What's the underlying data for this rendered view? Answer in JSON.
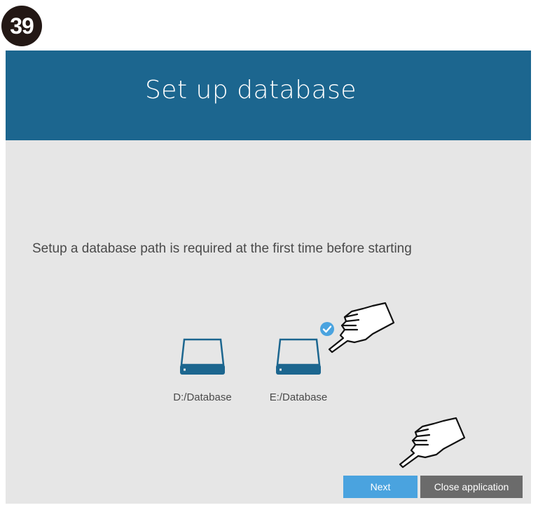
{
  "step": {
    "number": "39"
  },
  "dialog": {
    "title": "Set up database",
    "instruction": "Setup a database path is required at the first time before starting"
  },
  "drives": [
    {
      "label": "D:/Database",
      "selected": false,
      "icon": "hard-drive-icon"
    },
    {
      "label": "E:/Database",
      "selected": true,
      "icon": "hard-drive-icon"
    }
  ],
  "buttons": {
    "next_label": "Next",
    "close_label": "Close application"
  },
  "colors": {
    "header": "#1c668f",
    "body": "#e6e6e6",
    "accent": "#4aa3df",
    "drive": "#1c668f",
    "close_button": "#6b6b6b"
  }
}
